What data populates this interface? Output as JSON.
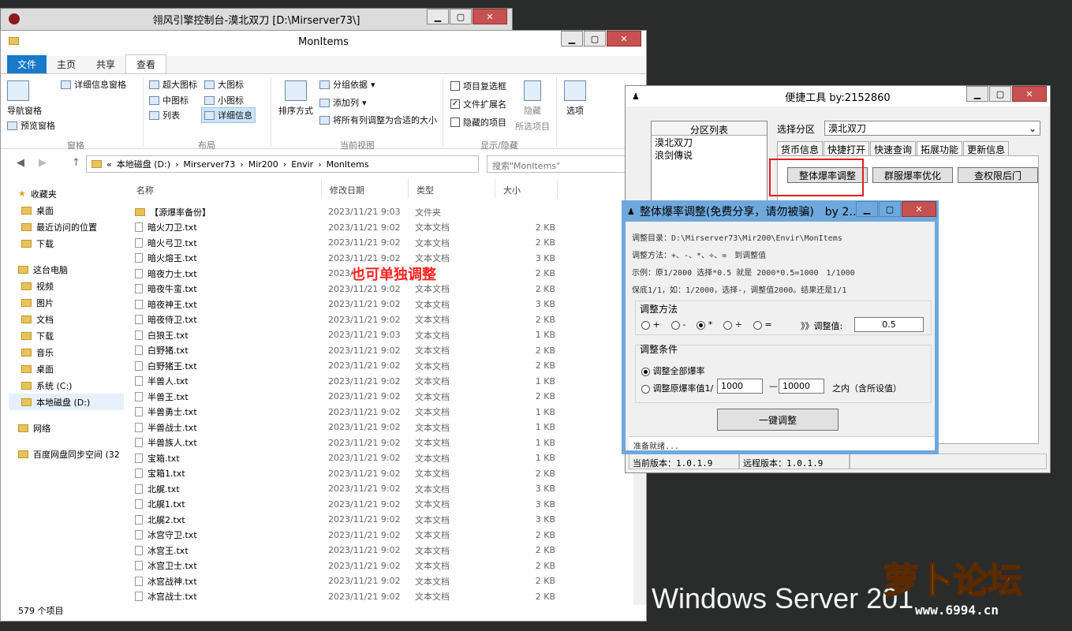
{
  "console": {
    "title": "翎风引擎控制台-漠北双刀 [D:\\Mirserver73\\]"
  },
  "explorer": {
    "title": "MonItems",
    "tabs": [
      "文件",
      "主页",
      "共享",
      "查看"
    ],
    "ribbon": {
      "nav_pane": "导航窗格",
      "preview_pane": "预览窗格",
      "details_pane": "详细信息窗格",
      "group_panes": "窗格",
      "extra_large": "超大图标",
      "large": "大图标",
      "medium": "中图标",
      "small": "小图标",
      "list": "列表",
      "details": "详细信息",
      "group_layout": "布局",
      "sort_by": "排序方式",
      "group_by": "分组依据",
      "add_column": "添加列",
      "fit_columns": "将所有列调整为合适的大小",
      "group_current_view": "当前视图",
      "item_checkboxes": "项目复选框",
      "file_ext": "文件扩展名",
      "hidden_items": "隐藏的项目",
      "hide_selected_1": "隐藏",
      "hide_selected_2": "所选项目",
      "group_show_hide": "显示/隐藏",
      "options": "选项"
    },
    "address": {
      "prefix": "«",
      "crumbs": [
        "本地磁盘 (D:)",
        "Mirserver73",
        "Mir200",
        "Envir",
        "MonItems"
      ]
    },
    "search_placeholder": "搜索\"MonItems\"",
    "nav": [
      {
        "label": "收藏夹",
        "icon": "star-icon"
      },
      {
        "label": "桌面",
        "icon": "desktop-icon"
      },
      {
        "label": "最近访问的位置",
        "icon": "recent-icon"
      },
      {
        "label": "下载",
        "icon": "download-icon"
      },
      {
        "label": "这台电脑",
        "icon": "computer-icon"
      },
      {
        "label": "视频",
        "icon": "folder-icon"
      },
      {
        "label": "图片",
        "icon": "folder-icon"
      },
      {
        "label": "文档",
        "icon": "folder-icon"
      },
      {
        "label": "下载",
        "icon": "download-icon"
      },
      {
        "label": "音乐",
        "icon": "folder-icon"
      },
      {
        "label": "桌面",
        "icon": "desktop-icon"
      },
      {
        "label": "系统 (C:)",
        "icon": "drive-icon"
      },
      {
        "label": "本地磁盘 (D:)",
        "icon": "drive-icon"
      },
      {
        "label": "网络",
        "icon": "network-icon"
      },
      {
        "label": "百度网盘同步空间 (32",
        "icon": "cloud-icon"
      }
    ],
    "columns": [
      "名称",
      "修改日期",
      "类型",
      "大小"
    ],
    "files": [
      {
        "name": "【源爆率备份】",
        "date": "2023/11/21 9:03",
        "type": "文件夹",
        "size": ""
      },
      {
        "name": "暗火刀卫.txt",
        "date": "2023/11/21 9:02",
        "type": "文本文档",
        "size": "2 KB"
      },
      {
        "name": "暗火弓卫.txt",
        "date": "2023/11/21 9:02",
        "type": "文本文档",
        "size": "2 KB"
      },
      {
        "name": "暗火熔王.txt",
        "date": "2023/11/21 9:02",
        "type": "文本文档",
        "size": "3 KB"
      },
      {
        "name": "暗夜力士.txt",
        "date": "2023/",
        "type": "",
        "size": "2 KB"
      },
      {
        "name": "暗夜牛蛮.txt",
        "date": "2023/11/21 9:02",
        "type": "文本文档",
        "size": "2 KB"
      },
      {
        "name": "暗夜神王.txt",
        "date": "2023/11/21 9:02",
        "type": "文本文档",
        "size": "3 KB"
      },
      {
        "name": "暗夜侍卫.txt",
        "date": "2023/11/21 9:02",
        "type": "文本文档",
        "size": "2 KB"
      },
      {
        "name": "白狼王.txt",
        "date": "2023/11/21 9:03",
        "type": "文本文档",
        "size": "1 KB"
      },
      {
        "name": "白野猪.txt",
        "date": "2023/11/21 9:02",
        "type": "文本文档",
        "size": "2 KB"
      },
      {
        "name": "白野猪王.txt",
        "date": "2023/11/21 9:02",
        "type": "文本文档",
        "size": "2 KB"
      },
      {
        "name": "半兽人.txt",
        "date": "2023/11/21 9:02",
        "type": "文本文档",
        "size": "1 KB"
      },
      {
        "name": "半兽王.txt",
        "date": "2023/11/21 9:02",
        "type": "文本文档",
        "size": "2 KB"
      },
      {
        "name": "半兽勇士.txt",
        "date": "2023/11/21 9:02",
        "type": "文本文档",
        "size": "1 KB"
      },
      {
        "name": "半兽战士.txt",
        "date": "2023/11/21 9:02",
        "type": "文本文档",
        "size": "1 KB"
      },
      {
        "name": "半兽族人.txt",
        "date": "2023/11/21 9:02",
        "type": "文本文档",
        "size": "1 KB"
      },
      {
        "name": "宝箱.txt",
        "date": "2023/11/21 9:02",
        "type": "文本文档",
        "size": "1 KB"
      },
      {
        "name": "宝箱1.txt",
        "date": "2023/11/21 9:02",
        "type": "文本文档",
        "size": "2 KB"
      },
      {
        "name": "北艉.txt",
        "date": "2023/11/21 9:02",
        "type": "文本文档",
        "size": "3 KB"
      },
      {
        "name": "北艉1.txt",
        "date": "2023/11/21 9:02",
        "type": "文本文档",
        "size": "3 KB"
      },
      {
        "name": "北艉2.txt",
        "date": "2023/11/21 9:02",
        "type": "文本文档",
        "size": "3 KB"
      },
      {
        "name": "冰宫守卫.txt",
        "date": "2023/11/21 9:02",
        "type": "文本文档",
        "size": "2 KB"
      },
      {
        "name": "冰宫王.txt",
        "date": "2023/11/21 9:02",
        "type": "文本文档",
        "size": "2 KB"
      },
      {
        "name": "冰宫卫士.txt",
        "date": "2023/11/21 9:02",
        "type": "文本文档",
        "size": "2 KB"
      },
      {
        "name": "冰宫战神.txt",
        "date": "2023/11/21 9:02",
        "type": "文本文档",
        "size": "2 KB"
      },
      {
        "name": "冰宫战士.txt",
        "date": "2023/11/21 9:02",
        "type": "文本文档",
        "size": "2 KB"
      }
    ],
    "status": "579 个项目"
  },
  "tool": {
    "title": "便捷工具 by:2152860",
    "list_header": "分区列表",
    "list_items": [
      "漠北双刀",
      "浪剑傳说"
    ],
    "select_label": "选择分区",
    "select_value": "漠北双刀",
    "tabs": [
      "货币信息",
      "快捷打开",
      "快速查询",
      "拓展功能",
      "更新信息"
    ],
    "btn_overall": "整体爆率调整",
    "btn_group": "群服爆率优化",
    "btn_backdoor": "查权限后门",
    "status_local": "当前版本：1.0.1.9",
    "status_remote": "远程版本：1.0.1.9"
  },
  "dialog": {
    "title": "整体爆率调整(免费分享，请勿被骗)　by 2…",
    "dir": "调整目录：D:\\Mirserver73\\Mir200\\Envir\\MonItems",
    "method_desc": "调整方法：+、-、*、÷、=　到调整值",
    "example": "示例：原1/2000 选择*0.5 就是 2000*0.5=1000　1/1000",
    "minimum": "保底1/1，如：1/2000，选择-，调整值2000。结果还是1/1",
    "method_group": "调整方法",
    "ops": [
      "+",
      "-",
      "*",
      "÷",
      "="
    ],
    "selected_op": "*",
    "value_label": "》》调整值:",
    "value": "0.5",
    "cond_group": "调整条件",
    "cond_all": "调整全部爆率",
    "cond_range": "调整原爆率值1/",
    "range_from": "1000",
    "range_dash": "—",
    "range_to": "10000",
    "range_suffix": "之内（含所设值）",
    "apply_btn": "一键调整",
    "status": "准备就绪..."
  },
  "annotation": "也可单独调整",
  "desktop": {
    "brand": "Windows Server 201",
    "logo_text": "萝卜论坛",
    "logo_url": "www.6994.cn"
  }
}
